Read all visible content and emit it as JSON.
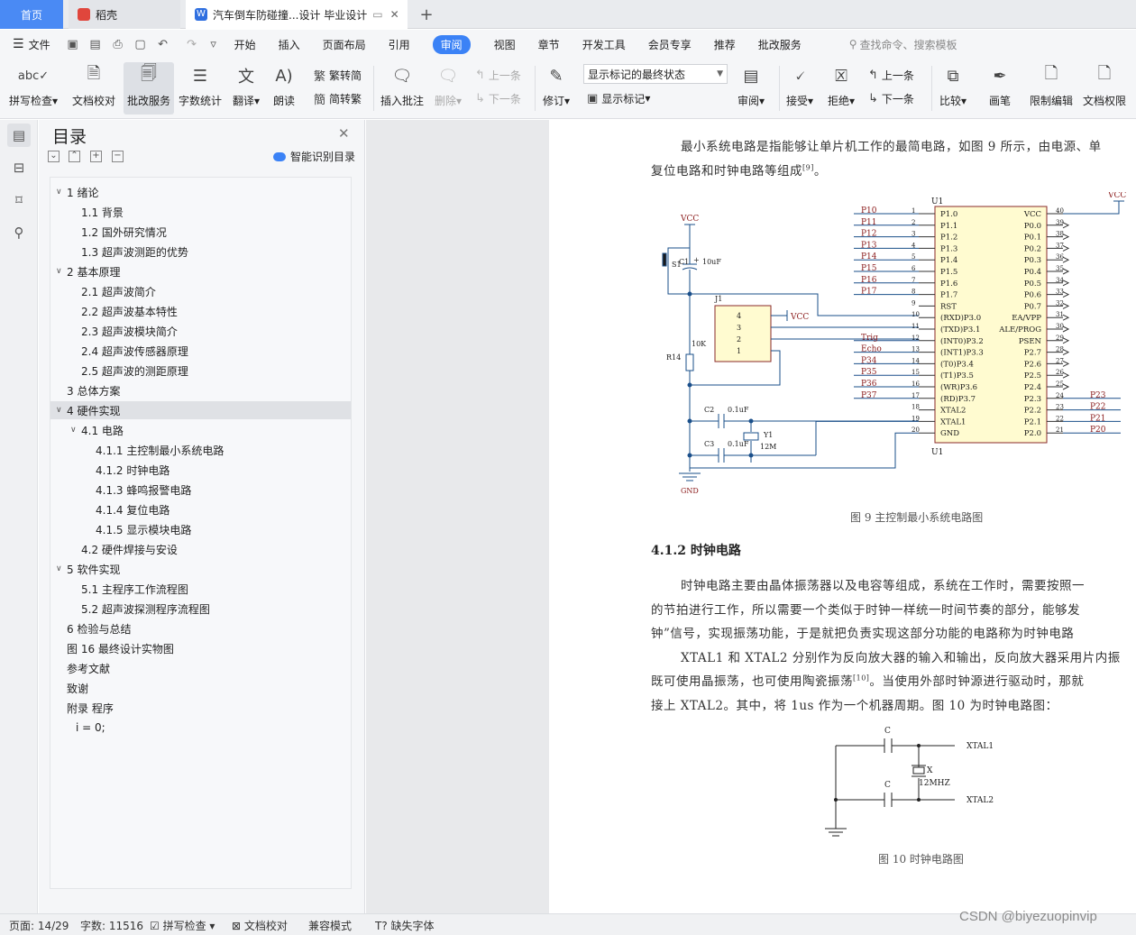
{
  "tabs": {
    "home": "首页",
    "daoke": "稻壳",
    "doc": "汽车倒车防碰撞...设计 毕业设计"
  },
  "menu": {
    "file": "文件",
    "items": [
      "开始",
      "插入",
      "页面布局",
      "引用",
      "审阅",
      "视图",
      "章节",
      "开发工具",
      "会员专享",
      "推荐",
      "批改服务"
    ],
    "active": "审阅",
    "search": "查找命令、搜索模板"
  },
  "ribbon": {
    "spell": "拼写检查",
    "proof": "文档校对",
    "grade": "批改服务",
    "wordcount": "字数统计",
    "translate": "翻译",
    "read": "朗读",
    "trad": "繁转简",
    "simp": "简转繁",
    "insert_comment": "插入批注",
    "delete": "删除",
    "prev": "上一条",
    "next": "下一条",
    "revise": "修订",
    "markup_state": "显示标记的最终状态",
    "show_markup": "显示标记",
    "review": "审阅",
    "accept": "接受",
    "reject": "拒绝",
    "prev2": "上一条",
    "next2": "下一条",
    "compare": "比较",
    "pen": "画笔",
    "restrict": "限制编辑",
    "rights": "文档权限"
  },
  "toc": {
    "title": "目录",
    "smart": "智能识别目录",
    "items": [
      {
        "t": "1  绪论",
        "lv": 0,
        "car": "∨"
      },
      {
        "t": "1.1  背景",
        "lv": 1
      },
      {
        "t": "1.2  国外研究情况",
        "lv": 1
      },
      {
        "t": "1.3  超声波测距的优势",
        "lv": 1
      },
      {
        "t": "2  基本原理",
        "lv": 0,
        "car": "∨"
      },
      {
        "t": "2.1  超声波简介",
        "lv": 1
      },
      {
        "t": "2.2  超声波基本特性",
        "lv": 1
      },
      {
        "t": "2.3  超声波模块简介",
        "lv": 1
      },
      {
        "t": "2.4  超声波传感器原理",
        "lv": 1
      },
      {
        "t": "2.5  超声波的测距原理",
        "lv": 1
      },
      {
        "t": "3  总体方案",
        "lv": 0
      },
      {
        "t": "4  硬件实现",
        "lv": 0,
        "car": "∨",
        "sel": true
      },
      {
        "t": "4.1  电路",
        "lv": 1,
        "car": "∨"
      },
      {
        "t": "4.1.1  主控制最小系统电路",
        "lv": 2
      },
      {
        "t": "4.1.2  时钟电路",
        "lv": 2
      },
      {
        "t": "4.1.3  蜂鸣报警电路",
        "lv": 2
      },
      {
        "t": "4.1.4  复位电路",
        "lv": 2
      },
      {
        "t": "4.1.5  显示模块电路",
        "lv": 2
      },
      {
        "t": "4.2  硬件焊接与安设",
        "lv": 1
      },
      {
        "t": "5  软件实现",
        "lv": 0,
        "car": "∨"
      },
      {
        "t": "5.1  主程序工作流程图",
        "lv": 1
      },
      {
        "t": "5.2  超声波探测程序流程图",
        "lv": 1
      },
      {
        "t": "6  检验与总结",
        "lv": 0
      },
      {
        "t": "图 16  最终设计实物图",
        "lv": 0
      },
      {
        "t": "参考文献",
        "lv": 0
      },
      {
        "t": "致谢",
        "lv": 0
      },
      {
        "t": "附录  程序",
        "lv": 0
      },
      {
        "t": "i = 0;",
        "lv": 3
      }
    ]
  },
  "doc": {
    "p1a": "最小系统电路是指能够让单片机工作的最简电路，如图 9 所示，由电源、单",
    "p1b": "复位电路和时钟电路等组成",
    "cite9": "[9]",
    "period": "。",
    "fig9": "图 9  主控制最小系统电路图",
    "h412": "4.1.2  时钟电路",
    "p2a": "时钟电路主要由晶体振荡器以及电容等组成，系统在工作时，需要按照一",
    "p2b": "的节拍进行工作，所以需要一个类似于时钟一样统一时间节奏的部分，能够发",
    "p2c": "钟”信号，实现振荡功能，于是就把负责实现这部分功能的电路称为时钟电路",
    "p3a": "XTAL1 和 XTAL2 分别作为反向放大器的输入和输出，反向放大器采用片内振",
    "p3b": "既可使用晶振荡，也可使用陶瓷振荡",
    "cite10": "[10]",
    "p3b2": "。当使用外部时钟源进行驱动时，那就",
    "p3c": "接上 XTAL2。其中，将 1us 作为一个机器周期。图 10 为时钟电路图：",
    "fig10": "图 10  时钟电路图"
  },
  "schematic": {
    "vcc": "VCC",
    "gnd": "GND",
    "s1": "S1",
    "c1": "C1",
    "c1v": "10uF",
    "plus": "+",
    "r14": "R14",
    "r14v": "10K",
    "j1": "J1",
    "j1pins": [
      "4",
      "3",
      "2",
      "1"
    ],
    "c2": "C2",
    "c2v": "0.1uF",
    "c3": "C3",
    "c3v": "0.1uF",
    "y1": "Y1",
    "y1v": "12M",
    "u1": "U1",
    "left_nets": [
      "P10",
      "P11",
      "P12",
      "P13",
      "P14",
      "P15",
      "P16",
      "P17",
      "",
      "",
      "",
      "Trig",
      "Echo",
      "P34",
      "P35",
      "P36",
      "P37",
      "",
      "",
      ""
    ],
    "left_pins": [
      "P1.0",
      "P1.1",
      "P1.2",
      "P1.3",
      "P1.4",
      "P1.5",
      "P1.6",
      "P1.7",
      "RST",
      "(RXD)P3.0",
      "(TXD)P3.1",
      "(INT0)P3.2",
      "(INT1)P3.3",
      "(T0)P3.4",
      "(T1)P3.5",
      "(WR)P3.6",
      "(RD)P3.7",
      "XTAL2",
      "XTAL1",
      "GND"
    ],
    "right_pins": [
      "VCC",
      "P0.0",
      "P0.1",
      "P0.2",
      "P0.3",
      "P0.4",
      "P0.5",
      "P0.6",
      "P0.7",
      "EA/VPP",
      "ALE/PROG",
      "PSEN",
      "P2.7",
      "P2.6",
      "P2.5",
      "P2.4",
      "P2.3",
      "P2.2",
      "P2.1",
      "P2.0"
    ],
    "right_nets": [
      "",
      "",
      "",
      "",
      "",
      "",
      "",
      "",
      "",
      "",
      "",
      "",
      "",
      "",
      "",
      "",
      "P23",
      "P22",
      "P21",
      "P20"
    ],
    "right_nums": [
      "40",
      "39",
      "38",
      "37",
      "36",
      "35",
      "34",
      "33",
      "32",
      "31",
      "30",
      "29",
      "28",
      "27",
      "26",
      "25",
      "24",
      "23",
      "22",
      "21"
    ],
    "clk_c": "C",
    "clk_x": "X",
    "clk_hz": "12MHZ",
    "xtal1": "XTAL1",
    "xtal2": "XTAL2"
  },
  "status": {
    "page": "页面: 14/29",
    "words": "字数: 11516",
    "spell": "拼写检查",
    "proof": "文档校对",
    "compat": "兼容模式",
    "font": "缺失字体"
  },
  "watermark": "CSDN @biyezuopinvip"
}
